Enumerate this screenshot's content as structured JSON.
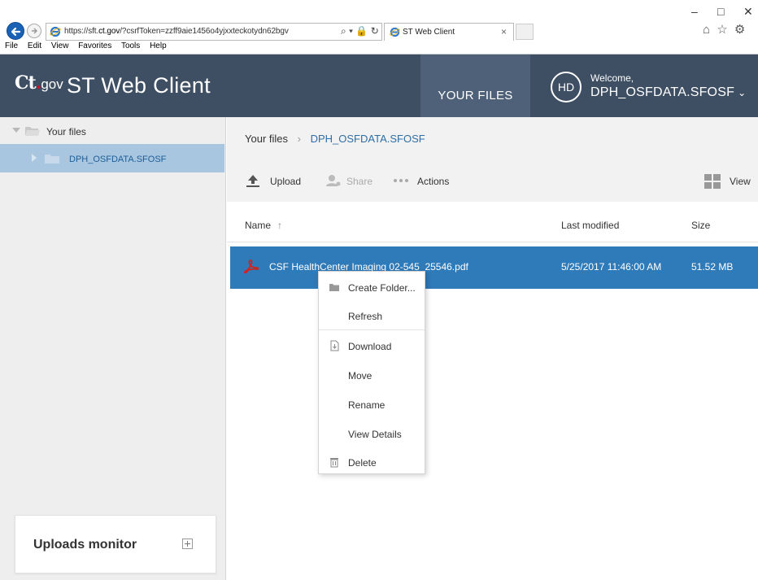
{
  "browser": {
    "url_prefix": "https://sft.",
    "url_domain": "ct.gov",
    "url_suffix": "/?csrfToken=zzff9aie1456o4yjxxteckotydn62bgv",
    "address_tools": "⌕ ▾ 🔒 ↻",
    "tab_title": "ST Web Client",
    "tab_close": "×",
    "menu": [
      "File",
      "Edit",
      "View",
      "Favorites",
      "Tools",
      "Help"
    ],
    "window_minimize": "–",
    "window_maximize": "□",
    "window_close": "✕",
    "toolbar_icons": [
      "⌂",
      "☆",
      "⚙"
    ]
  },
  "header": {
    "logo_ct": "Ct",
    "logo_dot": ".",
    "logo_gov": "gov",
    "app_title": "ST Web Client",
    "nav_your_files": "YOUR FILES",
    "avatar_initials": "HD",
    "welcome": "Welcome,",
    "username": "DPH_OSFDATA.SFOSF",
    "username_chevron": "⌄"
  },
  "sidebar": {
    "root_label": "Your files",
    "child_label": "DPH_OSFDATA.SFOSF",
    "uploads_monitor": "Uploads monitor"
  },
  "main": {
    "breadcrumb_root": "Your files",
    "breadcrumb_separator": "›",
    "breadcrumb_current": "DPH_OSFDATA.SFOSF",
    "actions": {
      "upload": "Upload",
      "share": "Share",
      "actions": "Actions",
      "view": "View"
    },
    "columns": {
      "name": "Name",
      "sort_arrow": "↑",
      "last_modified": "Last modified",
      "size": "Size"
    },
    "files": [
      {
        "name": "CSF HealthCenter Imaging 02-545_25546.pdf",
        "last_modified": "5/25/2017 11:46:00 AM",
        "size": "51.52 MB"
      }
    ]
  },
  "context_menu": {
    "items": [
      "Create Folder...",
      "Refresh",
      "Download",
      "Move",
      "Rename",
      "View Details",
      "Delete"
    ]
  },
  "colors": {
    "header_bg": "#3e4f64",
    "nav_active_bg": "#4e6178",
    "selection_blue": "#2f7ab9",
    "tree_selected": "#a9c6e0",
    "link_blue": "#2f6ea6",
    "pdf_red": "#d0241c"
  }
}
